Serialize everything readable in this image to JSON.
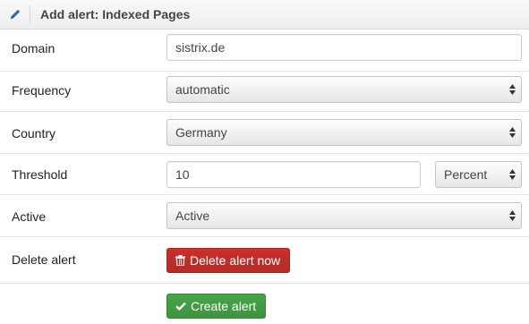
{
  "header": {
    "title": "Add alert: Indexed Pages",
    "icon": "pencil-icon"
  },
  "form": {
    "domain": {
      "label": "Domain",
      "value": "sistrix.de"
    },
    "frequency": {
      "label": "Frequency",
      "value": "automatic"
    },
    "country": {
      "label": "Country",
      "value": "Germany"
    },
    "threshold": {
      "label": "Threshold",
      "value": "10",
      "unit": "Percent"
    },
    "active": {
      "label": "Active",
      "value": "Active"
    },
    "delete": {
      "label": "Delete alert",
      "button": "Delete alert now",
      "icon": "trash-icon"
    }
  },
  "actions": {
    "create": "Create alert",
    "icon": "checkmark-icon"
  },
  "colors": {
    "danger": "#c9302c",
    "success": "#47a447",
    "accent": "#2a6ebb"
  }
}
